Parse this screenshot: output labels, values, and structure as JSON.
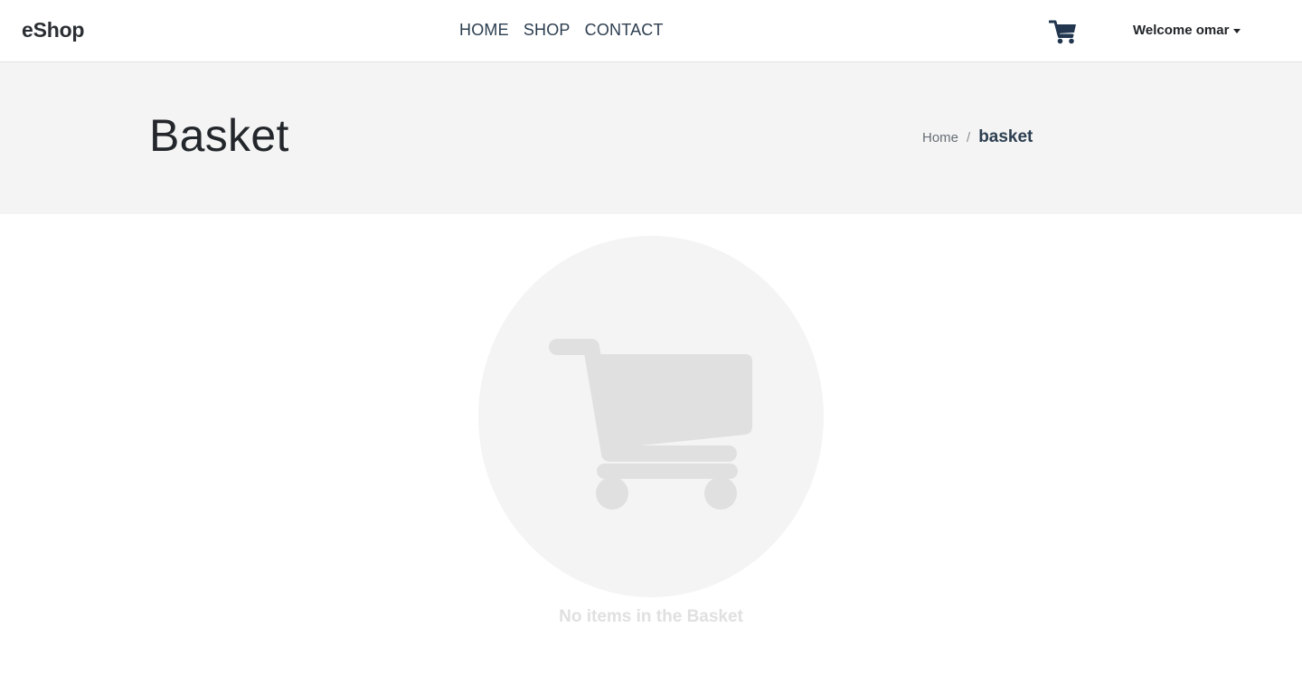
{
  "navbar": {
    "brand": "eShop",
    "links": [
      "HOME",
      "SHOP",
      "CONTACT"
    ],
    "cart_icon": "shopping-cart-icon",
    "user_menu_label": "Welcome omar"
  },
  "header": {
    "title": "Basket",
    "breadcrumb": {
      "home": "Home",
      "separator": "/",
      "current": "basket"
    }
  },
  "empty_state": {
    "icon": "shopping-cart-icon",
    "message": "No items in the Basket"
  },
  "colors": {
    "header_bg": "#f4f4f4",
    "nav_text": "#2c3e50",
    "empty_icon": "#e0e0e0"
  }
}
